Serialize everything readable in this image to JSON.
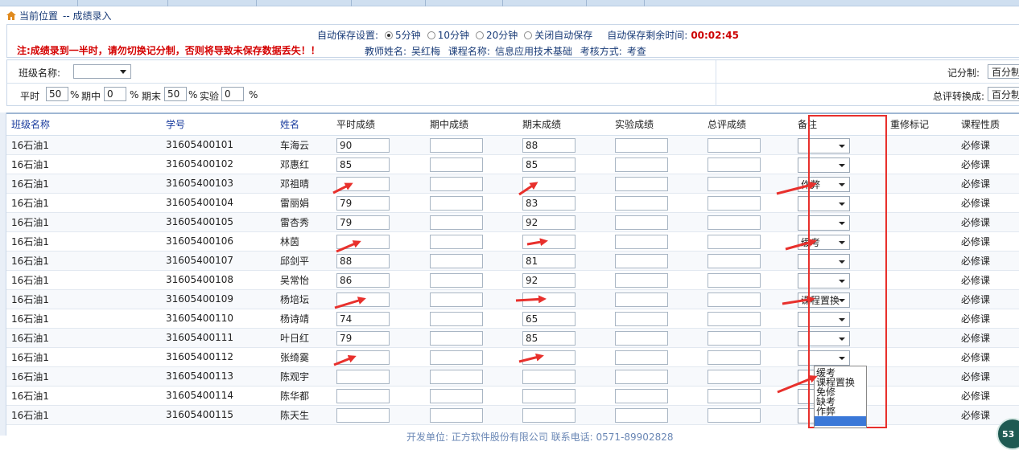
{
  "breadcrumb": {
    "label": "当前位置",
    "current": "-- 成绩录入"
  },
  "autosave": {
    "label": "自动保存设置:",
    "options": [
      {
        "label": "5分钟",
        "checked": true
      },
      {
        "label": "10分钟",
        "checked": false
      },
      {
        "label": "20分钟",
        "checked": false
      },
      {
        "label": "关闭自动保存",
        "checked": false
      }
    ],
    "remaining_label": "自动保存剩余时间:",
    "remaining_value": "00:02:45"
  },
  "warning": "注:成绩录到一半时，请勿切换记分制，否则将导致未保存数据丢失！！",
  "teacher_info": {
    "teacher_label": "教师姓名:",
    "teacher_name": "吴红梅",
    "course_label": "课程名称:",
    "course_name": "信息应用技术基础",
    "exam_label": "考核方式:",
    "exam_mode": "考查"
  },
  "filter": {
    "class_label": "班级名称:",
    "class_value": "",
    "score_system_label": "记分制:",
    "score_system_value": "百分制",
    "convert_label": "总评转换成:",
    "convert_value": "百分制",
    "weights": {
      "usual_label": "平时",
      "usual_value": "50",
      "usual_unit": "%",
      "mid_label": "期中",
      "mid_value": "0",
      "mid_unit": "%",
      "final_label": "期末",
      "final_value": "50",
      "final_unit": "%",
      "lab_label": "实验",
      "lab_value": "0",
      "lab_unit": "%"
    }
  },
  "table": {
    "headers": [
      "班级名称",
      "学号",
      "姓名",
      "平时成绩",
      "期中成绩",
      "期末成绩",
      "实验成绩",
      "总评成绩",
      "备注",
      "重修标记",
      "课程性质"
    ],
    "rows": [
      {
        "cls": "16石油1",
        "id": "31605400101",
        "name": "车海云",
        "usual": "90",
        "mid": "",
        "final": "88",
        "lab": "",
        "total": "",
        "remark": "",
        "retake": "",
        "nature": "必修课"
      },
      {
        "cls": "16石油1",
        "id": "31605400102",
        "name": "邓惠红",
        "usual": "85",
        "mid": "",
        "final": "85",
        "lab": "",
        "total": "",
        "remark": "",
        "retake": "",
        "nature": "必修课"
      },
      {
        "cls": "16石油1",
        "id": "31605400103",
        "name": "邓祖晴",
        "usual": "",
        "mid": "",
        "final": "",
        "lab": "",
        "total": "",
        "remark": "作弊",
        "retake": "",
        "nature": "必修课"
      },
      {
        "cls": "16石油1",
        "id": "31605400104",
        "name": "雷丽娟",
        "usual": "79",
        "mid": "",
        "final": "83",
        "lab": "",
        "total": "",
        "remark": "",
        "retake": "",
        "nature": "必修课"
      },
      {
        "cls": "16石油1",
        "id": "31605400105",
        "name": "雷杏秀",
        "usual": "79",
        "mid": "",
        "final": "92",
        "lab": "",
        "total": "",
        "remark": "",
        "retake": "",
        "nature": "必修课"
      },
      {
        "cls": "16石油1",
        "id": "31605400106",
        "name": "林茵",
        "usual": "",
        "mid": "",
        "final": "",
        "lab": "",
        "total": "",
        "remark": "缓考",
        "retake": "",
        "nature": "必修课"
      },
      {
        "cls": "16石油1",
        "id": "31605400107",
        "name": "邱剑平",
        "usual": "88",
        "mid": "",
        "final": "81",
        "lab": "",
        "total": "",
        "remark": "",
        "retake": "",
        "nature": "必修课"
      },
      {
        "cls": "16石油1",
        "id": "31605400108",
        "name": "吴常怡",
        "usual": "86",
        "mid": "",
        "final": "92",
        "lab": "",
        "total": "",
        "remark": "",
        "retake": "",
        "nature": "必修课"
      },
      {
        "cls": "16石油1",
        "id": "31605400109",
        "name": "杨培坛",
        "usual": "",
        "mid": "",
        "final": "",
        "lab": "",
        "total": "",
        "remark": "课程置换",
        "retake": "",
        "nature": "必修课"
      },
      {
        "cls": "16石油1",
        "id": "31605400110",
        "name": "杨诗靖",
        "usual": "74",
        "mid": "",
        "final": "65",
        "lab": "",
        "total": "",
        "remark": "",
        "retake": "",
        "nature": "必修课"
      },
      {
        "cls": "16石油1",
        "id": "31605400111",
        "name": "叶日红",
        "usual": "79",
        "mid": "",
        "final": "85",
        "lab": "",
        "total": "",
        "remark": "",
        "retake": "",
        "nature": "必修课"
      },
      {
        "cls": "16石油1",
        "id": "31605400112",
        "name": "张绮霙",
        "usual": "",
        "mid": "",
        "final": "",
        "lab": "",
        "total": "",
        "remark": "",
        "retake": "",
        "nature": "必修课"
      },
      {
        "cls": "16石油1",
        "id": "31605400113",
        "name": "陈观宇",
        "usual": "",
        "mid": "",
        "final": "",
        "lab": "",
        "total": "",
        "remark": "",
        "retake": "",
        "nature": "必修课"
      },
      {
        "cls": "16石油1",
        "id": "31605400114",
        "name": "陈华都",
        "usual": "",
        "mid": "",
        "final": "",
        "lab": "",
        "total": "",
        "remark": "",
        "retake": "",
        "nature": "必修课"
      },
      {
        "cls": "16石油1",
        "id": "31605400115",
        "name": "陈天生",
        "usual": "",
        "mid": "",
        "final": "",
        "lab": "",
        "total": "",
        "remark": "",
        "retake": "",
        "nature": "必修课"
      }
    ]
  },
  "remark_dropdown": {
    "options": [
      "缓考",
      "课程置换",
      "免修",
      "缺考",
      "作弊",
      ""
    ],
    "highlighted": 5
  },
  "footer": "开发单位: 正方软件股份有限公司  联系电话: 0571-89902828",
  "badge": "53",
  "colors": {
    "accent_red": "#e8302c",
    "link_blue": "#1a3c9e",
    "warning": "#d40000"
  }
}
